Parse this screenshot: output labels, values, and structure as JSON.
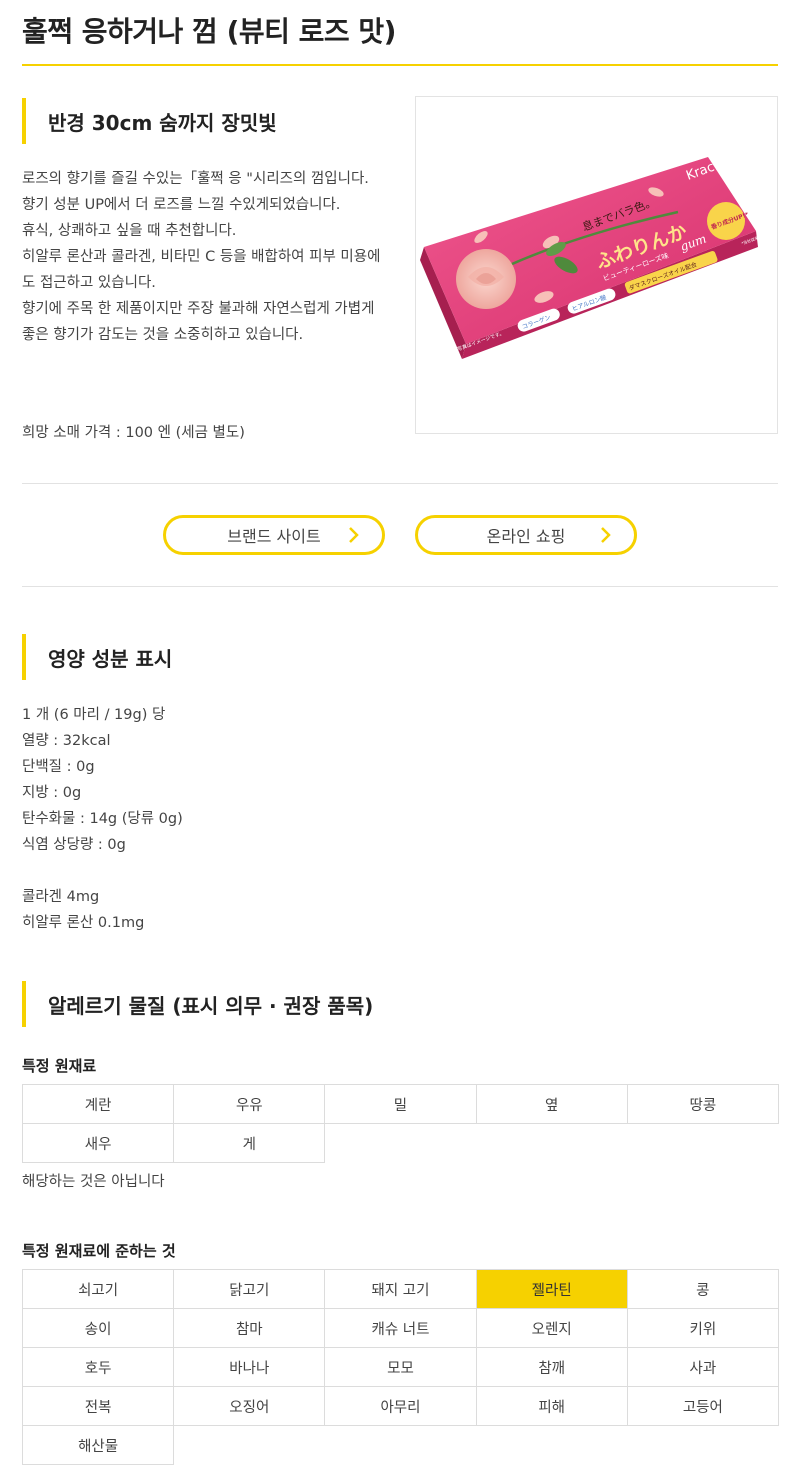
{
  "page_title": "훌쩍 응하거나 껌 (뷰티 로즈 맛)",
  "section1": {
    "heading": "반경 30cm 숨까지 장밋빛",
    "description": [
      "로즈의 향기를 즐길 수있는「훌쩍 응 \"시리즈의 껌입니다.",
      "향기 성분 UP에서 더 로즈를 느낄 수있게되었습니다.",
      "휴식, 상쾌하고 싶을 때 추천합니다.",
      "히알루 론산과 콜라겐, 비타민 C 등을 배합하여 피부 미용에도 접근하고 있습니다.",
      "향기에 주목 한 제품이지만 주장 불과해 자연스럽게 가볍게 좋은 향기가 감도는 것을 소중히하고 있습니다."
    ],
    "price": "희망 소매 가격 : 100 엔 (세금 별도)"
  },
  "product_image": {
    "brand": "Kracie",
    "tagline": "息までバラ色。",
    "product_name": "ふわりんか",
    "flavor_line": "ビューティーローズ味",
    "gum": "gum",
    "badge": "香り成分UP!*",
    "side_note": "*当社従来品と比較",
    "tags": [
      "コラーゲン",
      "ヒアルロン酸",
      "ダマスクローズオイル配合"
    ],
    "corner_note": "写真はイメージです。",
    "colors": {
      "box_pink": "#e23d78",
      "box_dark": "#b8245a",
      "rose": "#f4b5ad",
      "leaf": "#4f8a3c"
    }
  },
  "buttons": {
    "brand_site": "브랜드 사이트",
    "online_shop": "온라인 쇼핑"
  },
  "nutrition": {
    "heading": "영양 성분 표시",
    "lines": [
      "1 개 (6 마리 / 19g) 당",
      "열량 : 32kcal",
      "단백질 : 0g",
      "지방 : 0g",
      "탄수화물 : 14g (당류 0g)",
      "식염 상당량 : 0g",
      "",
      "콜라겐 4mg",
      "히알루 론산 0.1mg"
    ]
  },
  "allergy": {
    "heading": "알레르기 물질 (표시 의무 · 권장 품목)",
    "specific": {
      "title": "특정 원재료",
      "items": [
        "계란",
        "우유",
        "밀",
        "옆",
        "땅콩",
        "새우",
        "게"
      ],
      "note": "해당하는 것은 아닙니다"
    },
    "quasi": {
      "title": "특정 원재료에 준하는 것",
      "items": [
        "쇠고기",
        "닭고기",
        "돼지 고기",
        "젤라틴",
        "콩",
        "송이",
        "참마",
        "캐슈 너트",
        "오렌지",
        "키위",
        "호두",
        "바나나",
        "모모",
        "참깨",
        "사과",
        "전복",
        "오징어",
        "아무리",
        "피해",
        "고등어",
        "해산물"
      ],
      "highlighted": "젤라틴"
    }
  },
  "colors": {
    "accent": "#f6d100",
    "text": "#333333",
    "border": "#dcdcdc"
  }
}
